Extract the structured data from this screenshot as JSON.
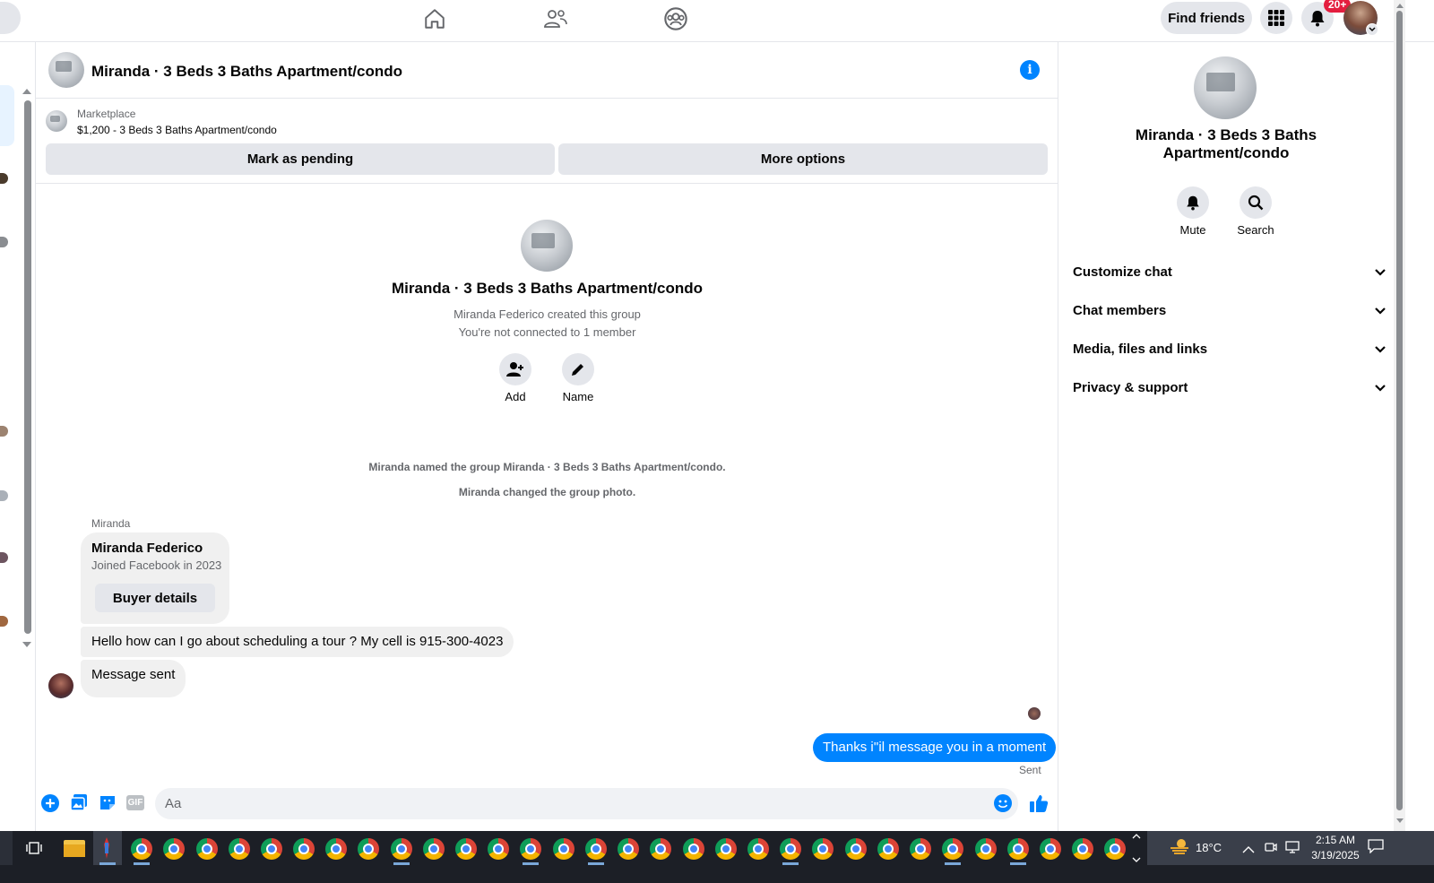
{
  "topbar": {
    "find_friends": "Find friends",
    "notif_badge": "20+"
  },
  "chat": {
    "header_title": "Miranda · 3 Beds 3 Baths Apartment/condo",
    "marketplace_label": "Marketplace",
    "listing_text": "$1,200 - 3 Beds 3 Baths Apartment/condo",
    "mark_pending": "Mark as pending",
    "more_options": "More options",
    "group_title": "Miranda · 3 Beds 3 Baths Apartment/condo",
    "created_by": "Miranda Federico created this group",
    "not_connected": "You're not connected to 1 member",
    "add_label": "Add",
    "name_label": "Name",
    "system_messages": [
      "Miranda named the group Miranda · 3 Beds 3 Baths Apartment/condo.",
      "Miranda changed the group photo."
    ],
    "sender_name": "Miranda",
    "card_name": "Miranda Federico",
    "card_joined": "Joined Facebook in 2023",
    "buyer_details": "Buyer details",
    "msg_1": "Hello how can I go about scheduling a tour ? My cell is 915-300-4023",
    "msg_2": "Message sent",
    "outgoing": "Thanks i''il message you in a moment",
    "sent_status": "Sent",
    "composer_placeholder": "Aa",
    "gif_label": "GIF"
  },
  "right_panel": {
    "title": "Miranda · 3 Beds 3 Baths Apartment/condo",
    "mute": "Mute",
    "search": "Search",
    "sections": [
      "Customize chat",
      "Chat members",
      "Media, files and links",
      "Privacy & support"
    ]
  },
  "taskbar": {
    "temperature": "18°C",
    "time": "2:15 AM",
    "date": "3/19/2025"
  },
  "colors": {
    "accent": "#0084ff",
    "grey_bubble": "#f0f0f0",
    "button_grey": "#e4e6eb",
    "badge_red": "#e41e3f"
  }
}
